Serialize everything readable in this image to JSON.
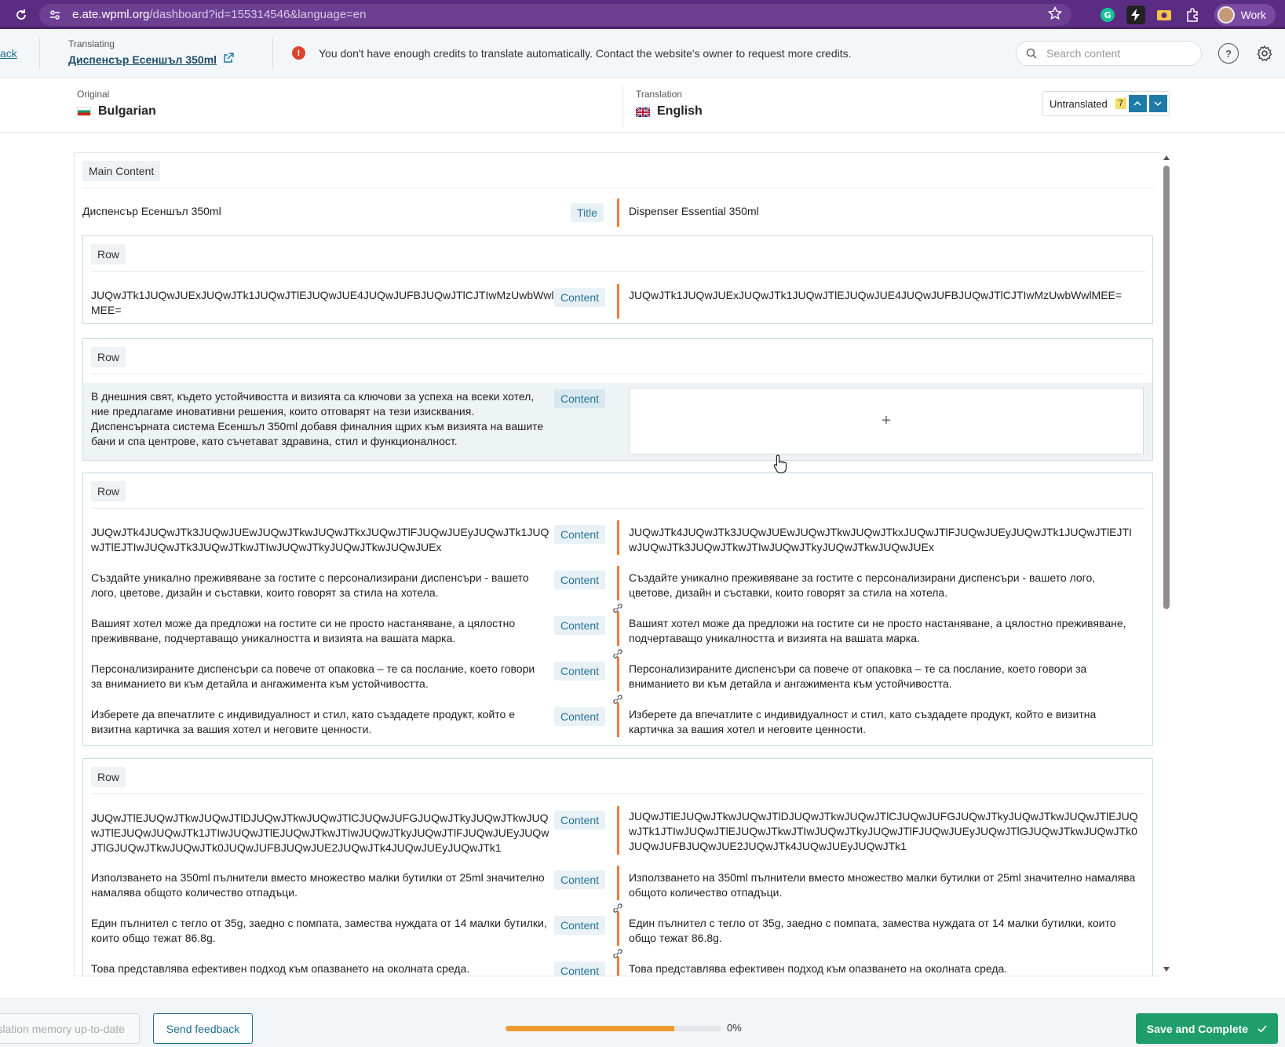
{
  "browser": {
    "url_host": "e.ate.wpml.org",
    "url_path": "/dashboard?id=155314546&language=en",
    "profile_label": "Work"
  },
  "header": {
    "back_label": "ack",
    "translating_label": "Translating",
    "document_title": "Диспенсър Есеншъл 350ml",
    "notice": "You don't have enough credits to translate automatically. Contact the website's owner to request more credits.",
    "search_placeholder": "Search content"
  },
  "languages": {
    "original_label": "Original",
    "original_lang": "Bulgarian",
    "translation_label": "Translation",
    "translation_lang": "English",
    "filter_label": "Untranslated",
    "filter_count": "7"
  },
  "colors": {
    "brand_purple": "#5b2d82",
    "accent_orange": "#f07b3a",
    "primary_blue": "#1f7aa8",
    "save_green": "#1f9e6b"
  },
  "content": {
    "main_label": "Main Content",
    "title_source": "Диспенсър Есеншъл 350ml",
    "title_tag": "Title",
    "title_target": "Dispenser Essential 350ml",
    "row_label": "Row",
    "content_tag": "Content",
    "row1": {
      "src": "JUQwJTk1JUQwJUExJUQwJTk1JUQwJTlEJUQwJUE4JUQwJUFBJUQwJTlCJTIwMzUwbWwlMEE=",
      "trg": "JUQwJTk1JUQwJUExJUQwJTk1JUQwJTlEJUQwJUE4JUQwJUFBJUQwJTlCJTIwMzUwbWwlMEE="
    },
    "row2": {
      "src": "В днешния свят, където устойчивостта и визията са ключови за успеха на всеки хотел, ние предлагаме иновативни решения, които отговарят на тези изисквания. Диспенсърната система Есеншъл 350ml добавя финалния щрих към визията на вашите бани и спа центрове, като съчетават здравина, стил и функционалност.",
      "add_symbol": "+"
    },
    "row3": [
      {
        "src": "JUQwJTk4JUQwJTk3JUQwJUEwJUQwJTkwJUQwJTkxJUQwJTlFJUQwJUEyJUQwJTk1JUQwJTlEJTIwJUQwJTk3JUQwJTkwJTIwJUQwJTkyJUQwJTkwJUQwJUEx",
        "trg": "JUQwJTk4JUQwJTk3JUQwJUEwJUQwJTkwJUQwJTkxJUQwJTlFJUQwJUEyJUQwJTk1JUQwJTlEJTIwJUQwJTk3JUQwJTkwJTIwJUQwJTkyJUQwJTkwJUQwJUEx"
      },
      {
        "src": "Създайте уникално преживяване за гостите с персонализирани диспенсъри - вашето лого, цветове, дизайн и съставки, които говорят за стила на хотела.",
        "trg": "Създайте уникално преживяване за гостите с персонализирани диспенсъри - вашето лого, цветове, дизайн и съставки, които говорят за стила на хотела."
      },
      {
        "src": "Вашият хотел може да предложи на гостите си не просто настаняване, а цялостно преживяване, подчертаващо уникалността и визията на вашата марка.",
        "trg": "Вашият хотел може да предложи на гостите си не просто настаняване, а цялостно преживяване, подчертаващо уникалността и визията на вашата марка."
      },
      {
        "src": "Персонализираните диспенсъри са повече от опаковка – те са послание, което говори за вниманието ви към детайла и ангажимента към устойчивостта.",
        "trg": "Персонализираните диспенсъри са повече от опаковка – те са послание, което говори за вниманието ви към детайла и ангажимента към устойчивостта."
      },
      {
        "src": "Изберете да впечатлите с индивидуалност и стил, като създадете продукт, който е визитна картичка за вашия хотел и неговите ценности.",
        "trg": "Изберете да впечатлите с индивидуалност и стил, като създадете продукт, който е визитна картичка за вашия хотел и неговите ценности."
      }
    ],
    "row4": [
      {
        "src": "JUQwJTlEJUQwJTkwJUQwJTlDJUQwJTkwJUQwJTlCJUQwJUFGJUQwJTkyJUQwJTkwJUQwJTlEJUQwJUQwJTk1JTIwJUQwJTlEJUQwJTkwJTIwJUQwJTkyJUQwJTlFJUQwJUEyJUQwJTlGJUQwJTkwJUQwJTk0JUQwJUFBJUQwJUE2JUQwJTk4JUQwJUEyJUQwJTk1",
        "trg": "JUQwJTlEJUQwJTkwJUQwJTlDJUQwJTkwJUQwJTlCJUQwJUFGJUQwJTkyJUQwJTkwJUQwJTlEJUQwJTk1JTIwJUQwJTlEJUQwJTkwJTIwJUQwJTkyJUQwJTlFJUQwJUEyJUQwJTlGJUQwJTkwJUQwJTk0JUQwJUFBJUQwJUE2JUQwJTk4JUQwJUEyJUQwJTk1"
      },
      {
        "src": "Използването на 350ml пълнители вместо множество малки бутилки от 25ml значително намалява общото количество отпадъци.",
        "trg": "Използването на 350ml пълнители вместо множество малки бутилки от 25ml значително намалява общото количество отпадъци."
      },
      {
        "src": "Един пълнител с тегло от 35g, заедно с помпата, замества нуждата от 14 малки бутилки, които общо тежат 86.8g.",
        "trg": "Един пълнител с тегло от 35g, заедно с помпата, замества нуждата от 14 малки бутилки, които общо тежат 86.8g."
      },
      {
        "src": "Това представлява ефективен подход към опазването на околната среда.",
        "trg": "Това представлява ефективен подход към опазването на околната среда."
      }
    ]
  },
  "footer": {
    "tm_label": "Translation memory up-to-date",
    "feedback_label": "Send feedback",
    "progress": 0.78,
    "progress_text": "0%",
    "save_label": "Save and Complete"
  }
}
